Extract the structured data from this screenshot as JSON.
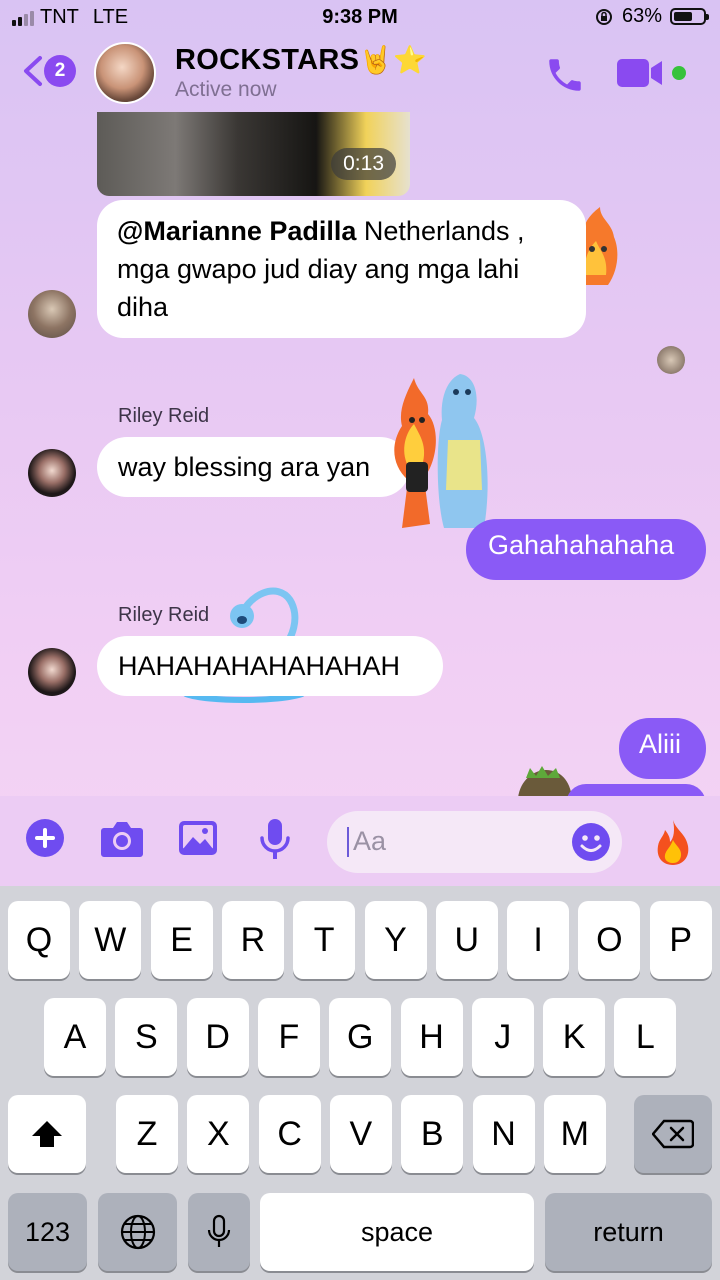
{
  "status_bar": {
    "carrier": "TNT",
    "network": "LTE",
    "time": "9:38 PM",
    "battery": "63%",
    "battery_level": 0.63
  },
  "header": {
    "unread_count": "2",
    "title": "ROCKSTARS",
    "title_emoji": "🤘⭐",
    "status": "Active now",
    "icons": [
      "back-chevron-icon",
      "phone-icon",
      "video-camera-icon"
    ]
  },
  "messages": {
    "video_duration": "0:13",
    "m1_mention": "@Marianne Padilla",
    "m1_text": " Netherlands , mga gwapo jud diay ang mga lahi diha",
    "m2_sender": "Riley Reid",
    "m2_text": "way blessing ara yan",
    "m3_text": "Gahahahahaha",
    "m4_sender": "Riley Reid",
    "m4_text": "HAHAHAHAHAHAHAH",
    "m5_text": "Aliii"
  },
  "composer": {
    "placeholder": "Aa",
    "icons": [
      "plus-icon",
      "camera-icon",
      "image-icon",
      "microphone-icon",
      "smiley-icon",
      "fire-emoji"
    ]
  },
  "keyboard": {
    "row1": [
      "Q",
      "W",
      "E",
      "R",
      "T",
      "Y",
      "U",
      "I",
      "O",
      "P"
    ],
    "row2": [
      "A",
      "S",
      "D",
      "F",
      "G",
      "H",
      "J",
      "K",
      "L"
    ],
    "row3": [
      "Z",
      "X",
      "C",
      "V",
      "B",
      "N",
      "M"
    ],
    "numbers": "123",
    "space": "space",
    "return": "return"
  }
}
